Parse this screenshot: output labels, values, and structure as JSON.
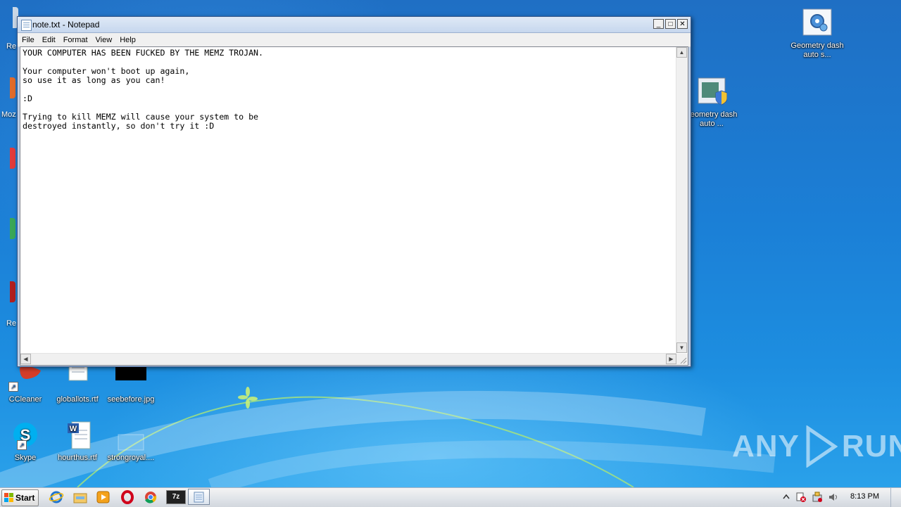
{
  "desktop": {
    "icons": [
      {
        "label": "Geometry dash auto s...",
        "name": "geometry-dash-settings"
      },
      {
        "label": "geometry dash auto ...",
        "name": "geometry-dash-installer"
      },
      {
        "label": "CCleaner",
        "name": "ccleaner"
      },
      {
        "label": "globallots.rtf",
        "name": "globallots-rtf"
      },
      {
        "label": "seebefore.jpg",
        "name": "seebefore-jpg"
      },
      {
        "label": "Skype",
        "name": "skype"
      },
      {
        "label": "hourthus.rtf",
        "name": "hourthus-rtf"
      },
      {
        "label": "strongroyal....",
        "name": "strongroyal"
      }
    ],
    "edge_labels": [
      "Re",
      "Moz",
      "Re"
    ],
    "watermark_left": "ANY",
    "watermark_right": "RUN"
  },
  "window": {
    "title": "note.txt - Notepad",
    "menu": [
      "File",
      "Edit",
      "Format",
      "View",
      "Help"
    ],
    "content": "YOUR COMPUTER HAS BEEN FUCKED BY THE MEMZ TROJAN.\n\nYour computer won't boot up again,\nso use it as long as you can!\n\n:D\n\nTrying to kill MEMZ will cause your system to be\ndestroyed instantly, so don't try it :D"
  },
  "taskbar": {
    "start_label": "Start",
    "clock": "8:13 PM",
    "pinned": [
      "internet-explorer-icon",
      "explorer-folder-icon",
      "media-player-icon",
      "opera-icon",
      "chrome-icon",
      "7zip-icon",
      "notepad-icon"
    ],
    "seven_zip_label": "7z"
  },
  "colors": {
    "desktop_bg": "#1b7fd6",
    "titlebar": "#c6d7ee",
    "taskbar": "#dfe3e8"
  }
}
